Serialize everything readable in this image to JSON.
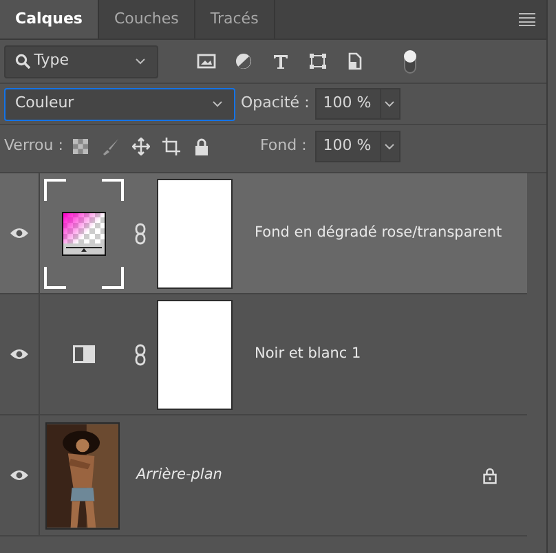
{
  "tabs": [
    {
      "label": "Calques",
      "selected": true
    },
    {
      "label": "Couches",
      "selected": false
    },
    {
      "label": "Tracés",
      "selected": false
    }
  ],
  "filter": {
    "value": "Type",
    "toggle_on": true
  },
  "blend": {
    "mode": "Couleur",
    "opacity_label": "Opacité :",
    "opacity": "100 %"
  },
  "lock": {
    "label": "Verrou :",
    "fill_label": "Fond :",
    "fill": "100 %"
  },
  "layers": [
    {
      "name": "Fond en dégradé rose/transparent",
      "kind": "gradient-fill",
      "selected": true,
      "visible": true,
      "mask": true,
      "locked": false
    },
    {
      "name": "Noir et blanc 1",
      "kind": "adjustment",
      "selected": false,
      "visible": true,
      "mask": true,
      "locked": false
    },
    {
      "name": "Arrière-plan",
      "kind": "background",
      "selected": false,
      "visible": true,
      "mask": false,
      "locked": true
    }
  ]
}
